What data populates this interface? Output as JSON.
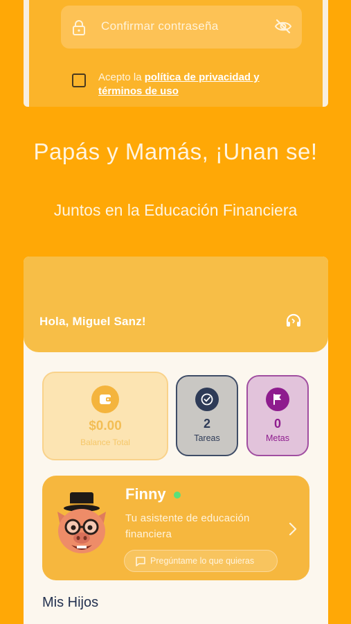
{
  "register": {
    "confirm_password_placeholder": "Confirmar contraseña",
    "terms_prefix": "Acepto la ",
    "terms_link": "política de privacidad y términos de uso",
    "terms_checked": false
  },
  "hero": {
    "title": "Papás y Mamás, ¡Unan se!",
    "subtitle": "Juntos en la Educación Financiera"
  },
  "app": {
    "greeting": "Hola, Miguel Sanz!",
    "stats": {
      "balance": {
        "value": "$0.00",
        "label": "Balance Total",
        "icon": "wallet-icon"
      },
      "tasks": {
        "value": "2",
        "label": "Tareas",
        "icon": "check-circle-icon"
      },
      "goals": {
        "value": "0",
        "label": "Metas",
        "icon": "flag-icon"
      }
    },
    "finny": {
      "name": "Finny",
      "description": "Tu asistente de educación financiera",
      "ask_label": "Pregúntame lo que quieras",
      "status": "online"
    },
    "children_heading": "Mis Hijos"
  },
  "colors": {
    "background": "#FFA806",
    "header": "#F7BE47",
    "tasks_accent": "#2E3B57",
    "goals_accent": "#8E1C8E",
    "online": "#5BE07A"
  }
}
